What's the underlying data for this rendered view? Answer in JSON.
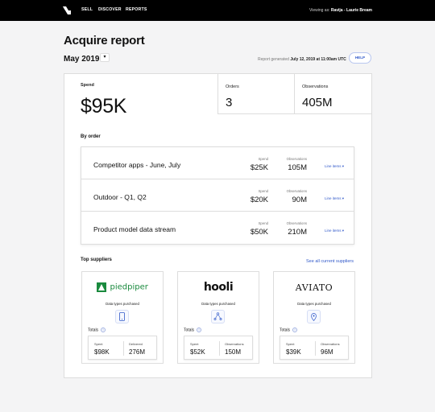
{
  "nav": {
    "items": [
      "SELL",
      "DISCOVER",
      "REPORTS"
    ],
    "viewing_prefix": "Viewing as:",
    "viewing_user": "Ravija - Laurie Bream"
  },
  "header": {
    "title": "Acquire report",
    "month": "May 2019",
    "generated_prefix": "Report generated",
    "generated_date": "July 12, 2019 at 11:00am UTC",
    "help_label": "HELP"
  },
  "summary": {
    "spend_label": "Spend",
    "spend_value": "$95K",
    "orders_label": "Orders",
    "orders_value": "3",
    "observations_label": "Observations",
    "observations_value": "405M"
  },
  "by_order": {
    "title": "By order",
    "spend_label": "Spend",
    "observations_label": "Observations",
    "line_items_label": "Line items",
    "rows": [
      {
        "name": "Competitor apps - June, July",
        "spend": "$25K",
        "observations": "105M"
      },
      {
        "name": "Outdoor - Q1, Q2",
        "spend": "$20K",
        "observations": "90M"
      },
      {
        "name": "Product model data stream",
        "spend": "$50K",
        "observations": "210M"
      }
    ]
  },
  "suppliers": {
    "title": "Top suppliers",
    "see_all": "See all current suppliers",
    "data_types_label": "Data types purchased",
    "totals_label": "Totals",
    "spend_label": "Spent",
    "delivered_label": "Delivered",
    "observations_label": "Observations",
    "items": [
      {
        "logo": "piedpiper",
        "spend": "$98K",
        "second_label": "Delivered",
        "second_value": "276M"
      },
      {
        "logo": "hooli",
        "spend": "$52K",
        "second_label": "Observations",
        "second_value": "150M"
      },
      {
        "logo": "AVIATO",
        "spend": "$39K",
        "second_label": "Observations",
        "second_value": "96M"
      }
    ]
  },
  "colors": {
    "accent": "#3159c9",
    "piedpiper_green": "#1a8a3e",
    "topbar": "#000000"
  }
}
